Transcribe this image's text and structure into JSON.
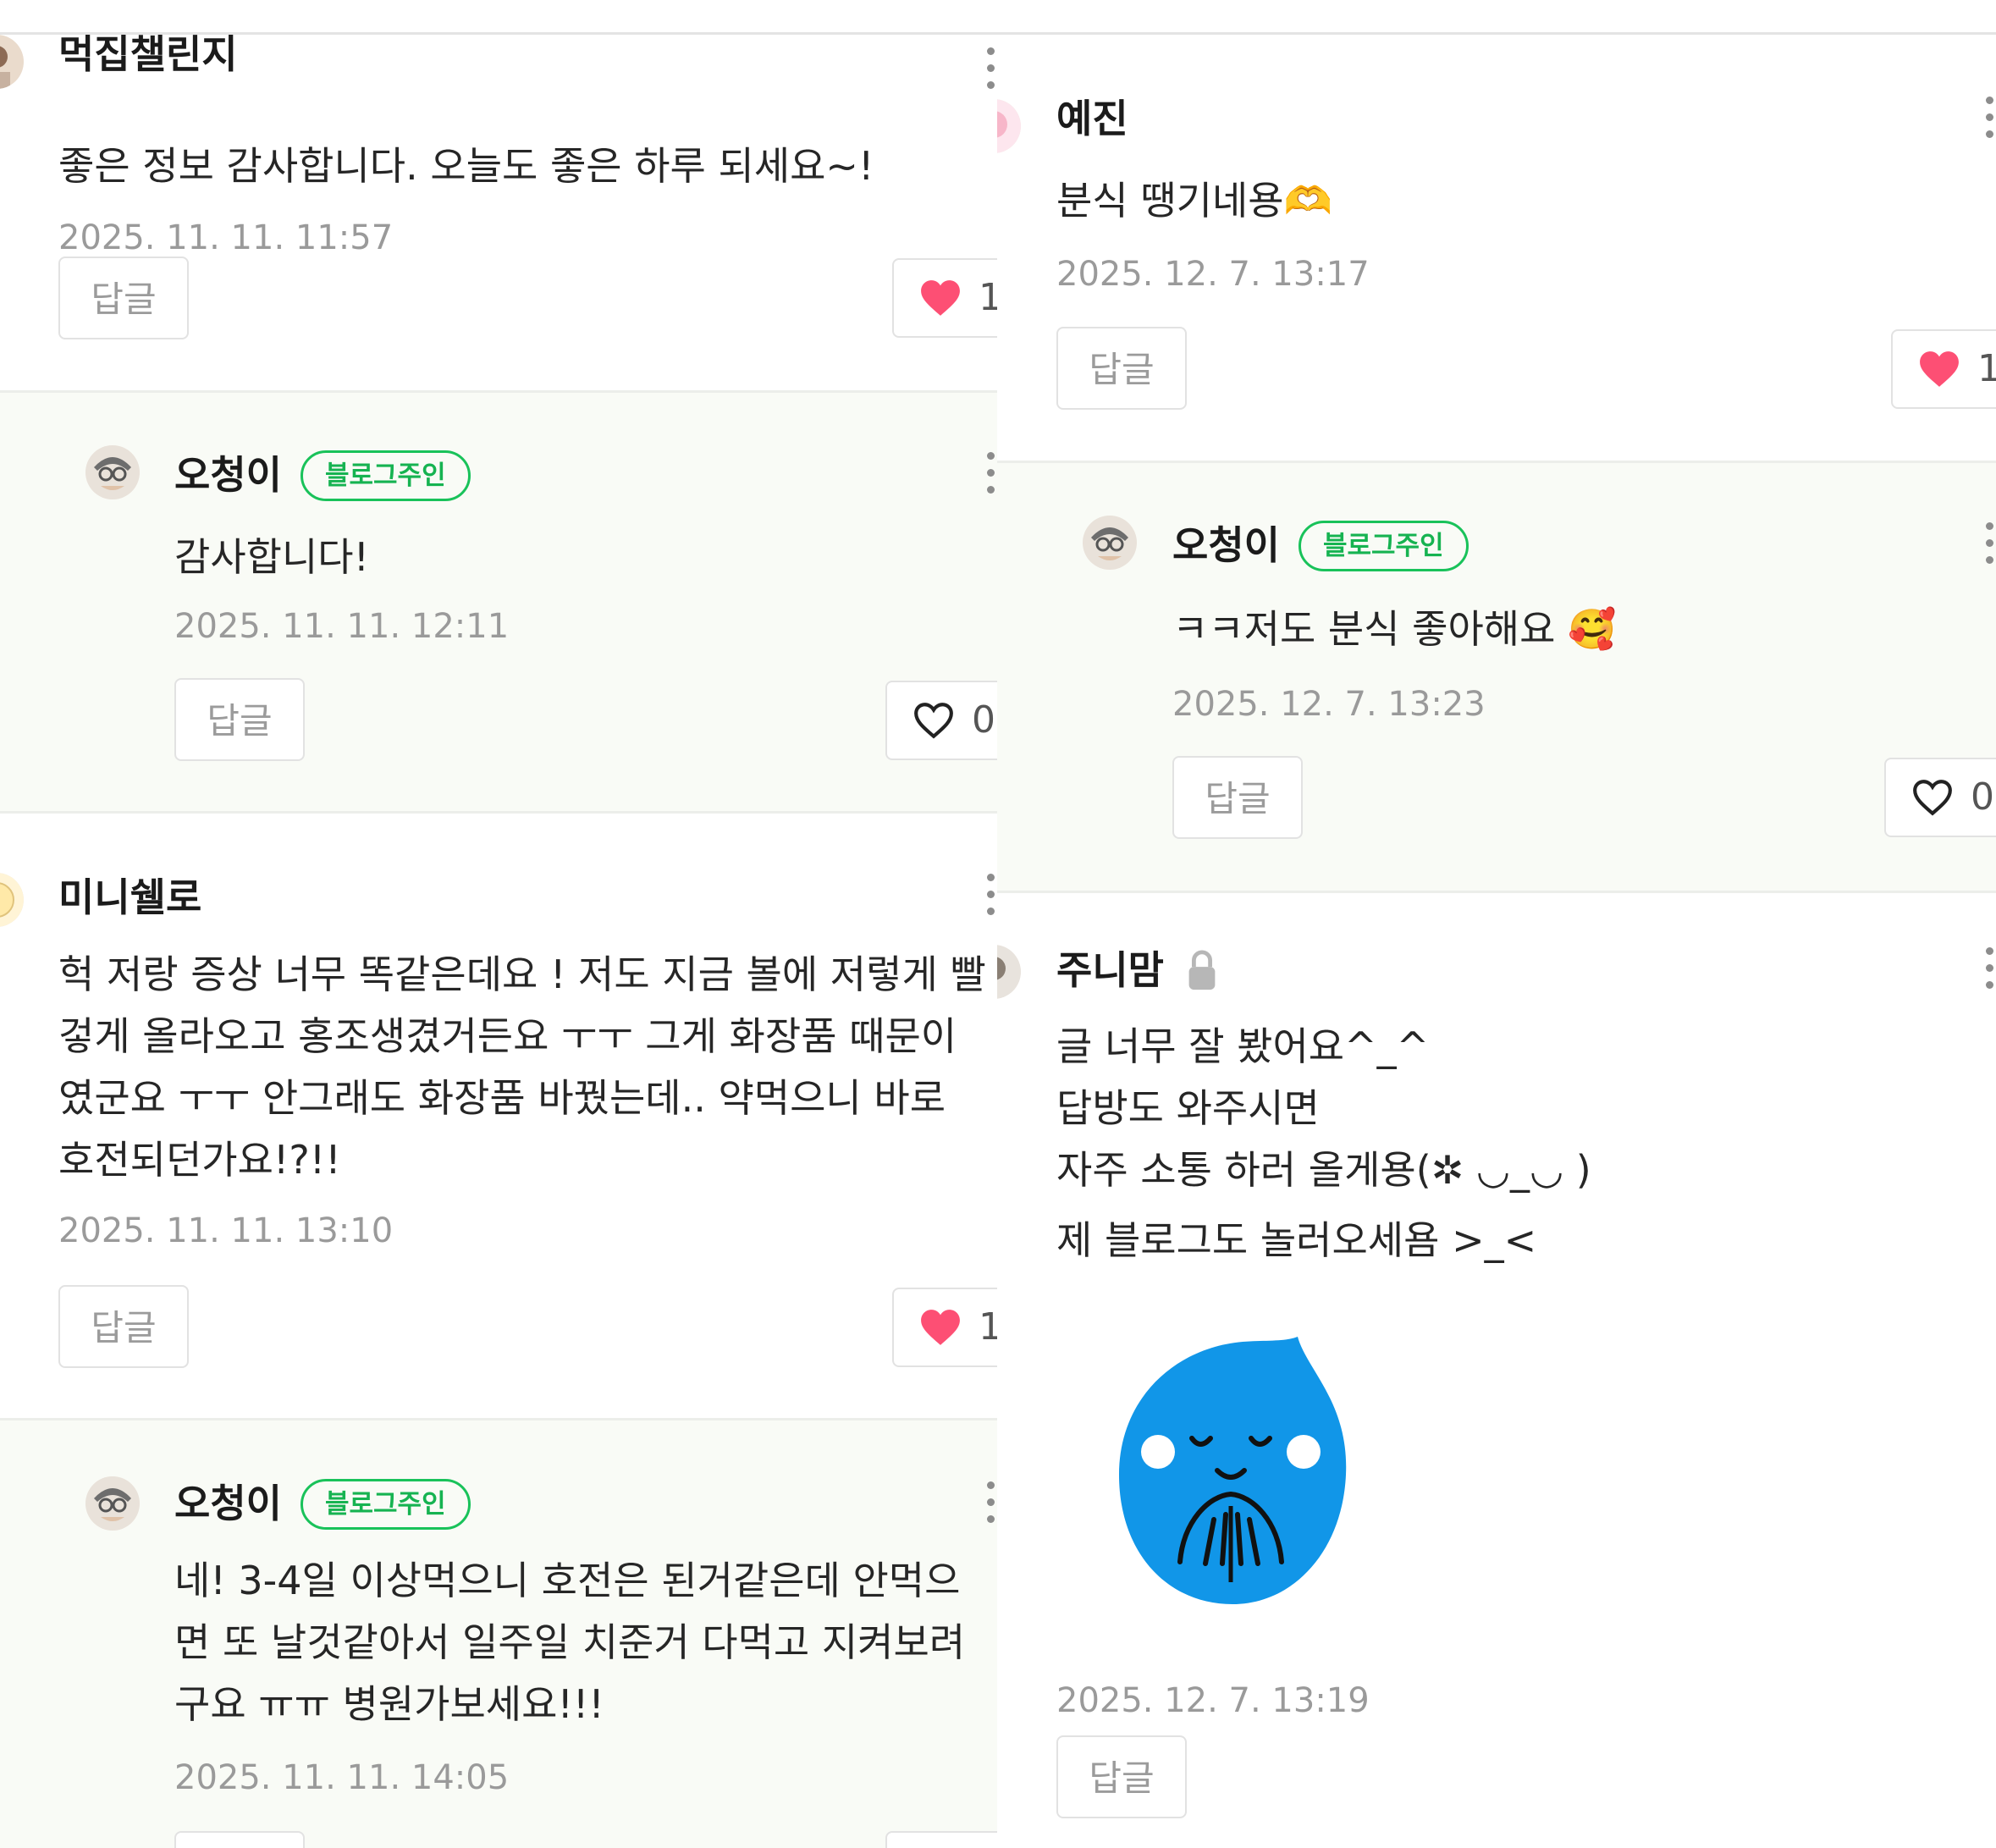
{
  "ui": {
    "reply_label": "답글",
    "owner_badge": "블로그주인"
  },
  "left": {
    "c1": {
      "name": "먹집챌린지",
      "text": "좋은 정보 감사합니다. 오늘도 좋은 하루 되세요~!",
      "date": "2025. 11. 11. 11:57",
      "likes": "1",
      "liked": true
    },
    "r1": {
      "name": "오청이",
      "text": "감사합니다!",
      "date": "2025. 11. 11. 12:11",
      "likes": "0",
      "liked": false
    },
    "c2": {
      "name": "미니쉘로",
      "lines": [
        "헉 저랑 증상 너무 똑같은데요 ! 저도 지금 볼에 저렇게 빨",
        "겋게 올라오고 홍조생겼거든요 ㅜㅜ 그게 화장품 때문이",
        "였군요 ㅜㅜ 안그래도 화장품 바꿨는데.. 약먹으니 바로",
        "호전되던가요!?!!"
      ],
      "date": "2025. 11. 11. 13:10",
      "likes": "1",
      "liked": true
    },
    "r2": {
      "name": "오청이",
      "lines": [
        "네! 3-4일 이상먹으니 호전은 된거같은데 안먹으",
        "면 또 날것같아서 일주일 치준거 다먹고 지켜보려",
        "구요 ㅠㅠ 병원가보세요!!!"
      ],
      "date": "2025. 11. 11. 14:05"
    }
  },
  "right": {
    "c1": {
      "name": "예진",
      "text": "분식 땡기네용🫶",
      "date": "2025. 12. 7. 13:17",
      "likes": "1",
      "liked": true
    },
    "r1": {
      "name": "오청이",
      "text": "ㅋㅋ저도 분식 좋아해요 🥰",
      "date": "2025. 12. 7. 13:23",
      "likes": "0",
      "liked": false
    },
    "c2": {
      "name": "주니맘",
      "lines": [
        "글 너무 잘 봤어요^_^",
        "답방도 와주시면",
        "자주 소통 하러 올게용(✲ ◡_◡ )",
        "제 블로그도 놀러오세욤 >_<"
      ],
      "date": "2025. 12. 7. 13:19"
    }
  },
  "colors": {
    "heart": "#fd4f74",
    "badge_green": "#19c25a",
    "sticker_blue": "#1196e8"
  },
  "icons": [
    "avatar",
    "more-icon",
    "heart-filled-icon",
    "heart-outline-icon",
    "lock-icon",
    "sticker-praying-drop"
  ]
}
